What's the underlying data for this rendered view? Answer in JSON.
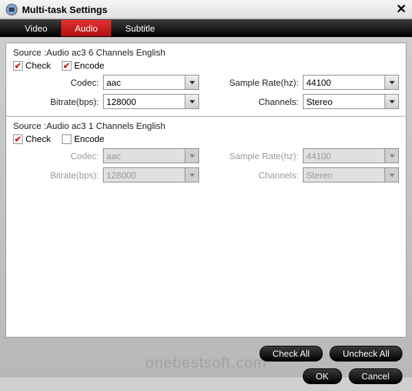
{
  "window": {
    "title": "Multi-task Settings"
  },
  "tabs": {
    "video": "Video",
    "audio": "Audio",
    "subtitle": "Subtitle",
    "active": "audio"
  },
  "labels": {
    "check": "Check",
    "encode": "Encode",
    "codec": "Codec:",
    "sample_rate": "Sample Rate(hz):",
    "bitrate": "Bitrate(bps):",
    "channels": "Channels:"
  },
  "tracks": [
    {
      "source": "Source :Audio  ac3  6 Channels  English",
      "check": true,
      "encode": true,
      "enabled": true,
      "codec": "aac",
      "sample_rate": "44100",
      "bitrate": "128000",
      "channels": "Stereo"
    },
    {
      "source": "Source :Audio  ac3  1 Channels  English",
      "check": true,
      "encode": false,
      "enabled": false,
      "codec": "aac",
      "sample_rate": "44100",
      "bitrate": "128000",
      "channels": "Stereo"
    }
  ],
  "buttons": {
    "check_all": "Check All",
    "uncheck_all": "Uncheck All",
    "ok": "OK",
    "cancel": "Cancel"
  },
  "watermark": "onebestsoft.com"
}
